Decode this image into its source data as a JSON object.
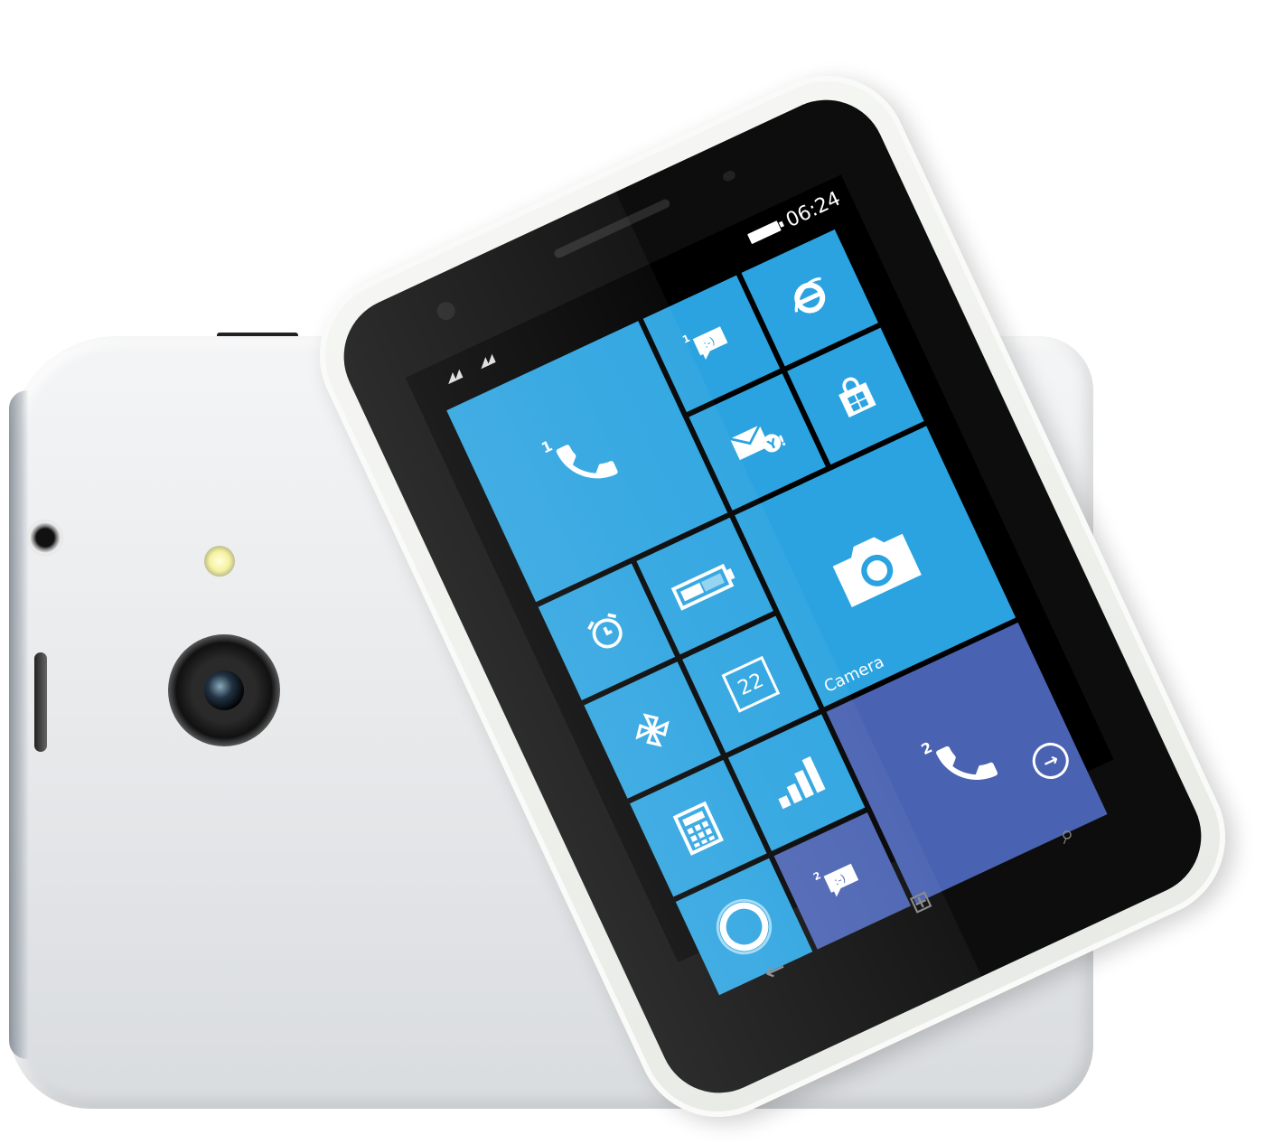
{
  "status": {
    "signal1": "◢◢",
    "signal2": "◢◢",
    "time": "06:24"
  },
  "tiles": {
    "phone1_badge": "1",
    "messaging1_badge": "1",
    "camera_label": "Camera",
    "calendar_day": "22",
    "phone2_badge": "2",
    "messaging2_badge": "2"
  },
  "icons": {
    "phone1": "phone-icon",
    "messaging1": "message-icon",
    "ie": "internet-explorer-icon",
    "mail": "mail-icon",
    "store": "store-icon",
    "alarm": "alarm-icon",
    "battery_saver": "battery-icon",
    "camera": "camera-icon",
    "pinwheel": "pinwheel-icon",
    "calendar": "calendar-icon",
    "calculator": "calculator-icon",
    "data_sense": "signal-bars-icon",
    "cortana": "cortana-ring-icon",
    "phone2": "phone-icon",
    "messaging2": "message-icon",
    "all_apps_arrow": "arrow-right-icon"
  },
  "nav": {
    "back": "←",
    "home": "⊞",
    "search": "⌕"
  },
  "arrow_button": {
    "glyph": "→"
  },
  "colors": {
    "tile_blue": "#2ba3e0",
    "tile_indigo": "#4a62b2",
    "screen_bg": "#000000",
    "phone_body": "#f0f2ef"
  }
}
